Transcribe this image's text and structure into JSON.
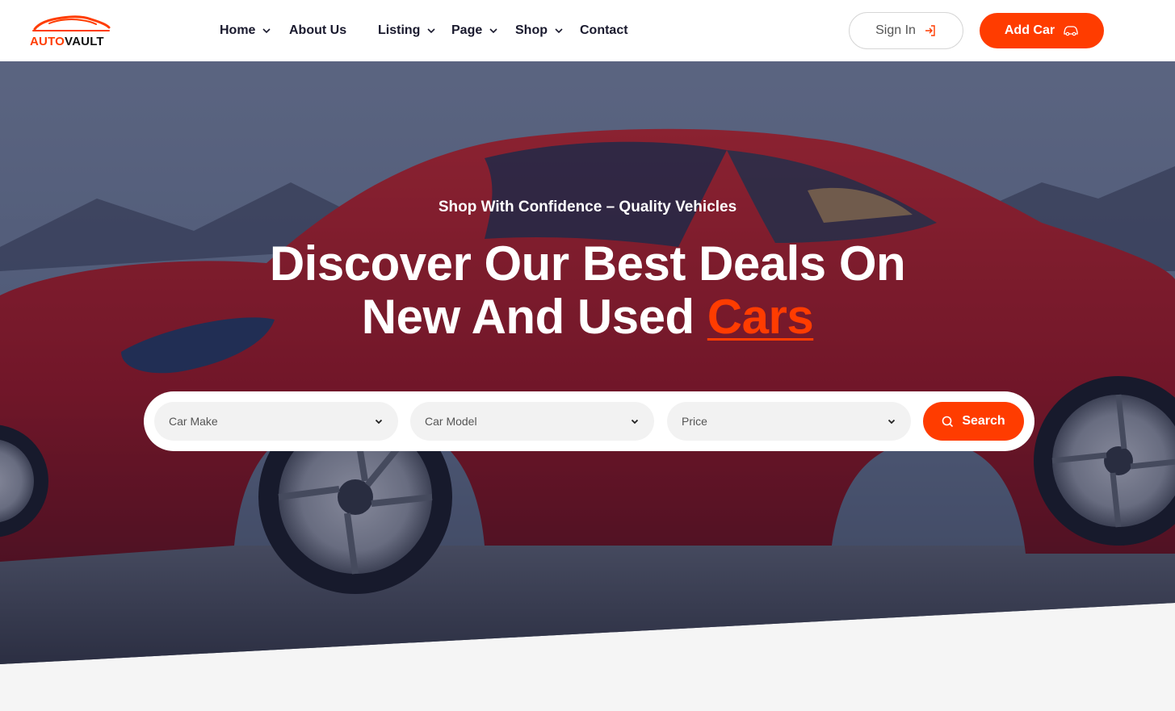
{
  "brand": {
    "name_part1": "AUTO",
    "name_part2": "VAULT",
    "accent_color": "#ff3c00"
  },
  "nav": {
    "items": [
      {
        "label": "Home",
        "has_dropdown": true
      },
      {
        "label": "About Us",
        "has_dropdown": false
      },
      {
        "label": "Listing",
        "has_dropdown": true
      },
      {
        "label": "Page",
        "has_dropdown": true
      },
      {
        "label": "Shop",
        "has_dropdown": true
      },
      {
        "label": "Contact",
        "has_dropdown": false
      }
    ]
  },
  "header_actions": {
    "signin_label": "Sign In",
    "addcar_label": "Add Car"
  },
  "hero": {
    "eyebrow": "Shop With Confidence – Quality Vehicles",
    "headline_line1": "Discover Our Best Deals On",
    "headline_line2_prefix": "New And Used ",
    "headline_accent": "Cars"
  },
  "search": {
    "filters": [
      {
        "label": "Car Make"
      },
      {
        "label": "Car Model"
      },
      {
        "label": "Price"
      }
    ],
    "button_label": "Search"
  }
}
